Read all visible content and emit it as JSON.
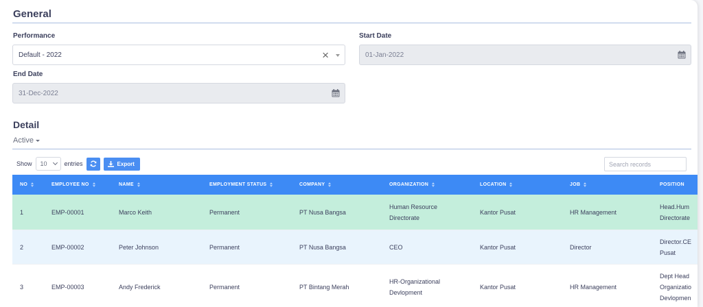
{
  "general": {
    "title": "General",
    "performance": {
      "label": "Performance",
      "value": "Default - 2022"
    },
    "start_date": {
      "label": "Start Date",
      "value": "01-Jan-2022"
    },
    "end_date": {
      "label": "End Date",
      "value": "31-Dec-2022"
    }
  },
  "detail": {
    "title": "Detail",
    "active_tab": "Active",
    "show_label": "Show",
    "entries_value": "10",
    "entries_label": "entries",
    "export_label": "Export",
    "search_placeholder": "Search records"
  },
  "table": {
    "columns": [
      "NO",
      "EMPLOYEE NO",
      "NAME",
      "EMPLOYMENT STATUS",
      "COMPANY",
      "ORGANIZATION",
      "LOCATION",
      "JOB",
      "POSITION"
    ],
    "rows": [
      {
        "no": "1",
        "employee_no": "EMP-00001",
        "name": "Marco Keith",
        "status": "Permanent",
        "company": "PT Nusa Bangsa",
        "organization": [
          "Human Resource",
          "Directorate"
        ],
        "location": "Kantor Pusat",
        "job": "HR Management",
        "position": [
          "Head.Hum",
          "Directorate"
        ]
      },
      {
        "no": "2",
        "employee_no": "EMP-00002",
        "name": "Peter Johnson",
        "status": "Permanent",
        "company": "PT Nusa Bangsa",
        "organization": [
          "CEO"
        ],
        "location": "Kantor Pusat",
        "job": "Director",
        "position": [
          "Director.CE",
          "Pusat"
        ]
      },
      {
        "no": "3",
        "employee_no": "EMP-00003",
        "name": "Andy Frederick",
        "status": "Permanent",
        "company": "PT Bintang Merah",
        "organization": [
          "HR-Organizational",
          "Devlopment"
        ],
        "location": "Kantor Pusat",
        "job": "HR Management",
        "position": [
          "Dept Head",
          "Organizatio",
          "Devlopmen"
        ]
      }
    ]
  },
  "colors": {
    "header": "#3d8af5",
    "row_selected": "#c4eedc",
    "row_alt": "#e9f4fd",
    "button": "#4a8ef2",
    "rule": "#a9bde0"
  }
}
